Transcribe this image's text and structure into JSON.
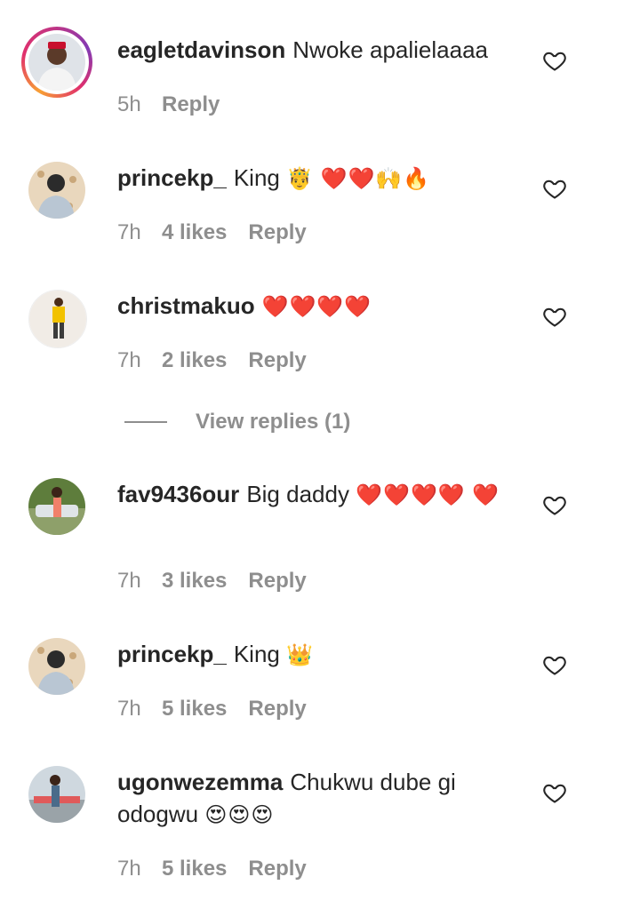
{
  "comments": [
    {
      "username": "eagletdavinson",
      "text": "Nwoke apalielaaaa",
      "emoji": "",
      "time": "5h",
      "likes": "",
      "reply": "Reply"
    },
    {
      "username": "princekp_",
      "text": "King",
      "emoji": "🤴 ❤️❤️🙌🔥",
      "time": "7h",
      "likes": "4 likes",
      "reply": "Reply"
    },
    {
      "username": "christmakuo",
      "text": "",
      "emoji": "❤️❤️❤️❤️",
      "time": "7h",
      "likes": "2 likes",
      "reply": "Reply"
    },
    {
      "username": "fav9436our",
      "text": "Big daddy",
      "emoji": "❤️❤️❤️❤️ ❤️",
      "time": "7h",
      "likes": "3 likes",
      "reply": "Reply"
    },
    {
      "username": "princekp_",
      "text": "King",
      "emoji": "👑",
      "time": "7h",
      "likes": "5 likes",
      "reply": "Reply"
    },
    {
      "username": "ugonwezemma",
      "text": "Chukwu dube gi odogwu",
      "emoji": "😍😍😍",
      "time": "7h",
      "likes": "5 likes",
      "reply": "Reply"
    }
  ],
  "view_replies": "View replies (1)",
  "icons": {
    "like": "heart-outline-icon"
  }
}
